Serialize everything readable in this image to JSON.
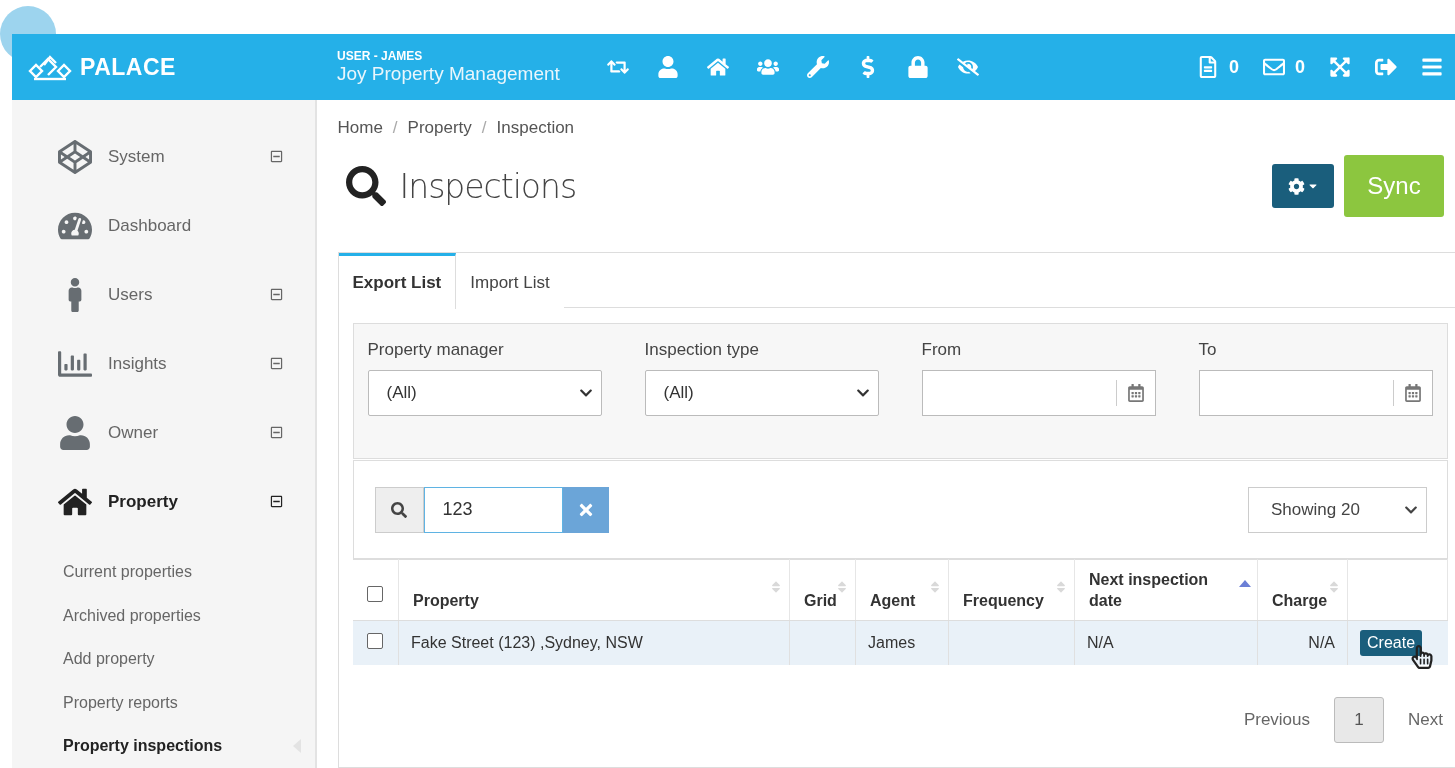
{
  "header": {
    "logo": "PALACE",
    "user_label": "USER - JAMES",
    "company": "Joy Property Management",
    "counters": [
      {
        "count": "0"
      },
      {
        "count": "0"
      }
    ]
  },
  "sidebar": {
    "items": [
      {
        "label": "System",
        "collapsible": true,
        "selected": false
      },
      {
        "label": "Dashboard",
        "collapsible": false,
        "selected": false
      },
      {
        "label": "Users",
        "collapsible": true,
        "selected": false
      },
      {
        "label": "Insights",
        "collapsible": true,
        "selected": false
      },
      {
        "label": "Owner",
        "collapsible": true,
        "selected": false
      },
      {
        "label": "Property",
        "collapsible": true,
        "selected": true,
        "children": [
          {
            "label": "Current properties",
            "selected": false
          },
          {
            "label": "Archived properties",
            "selected": false
          },
          {
            "label": "Add property",
            "selected": false
          },
          {
            "label": "Property reports",
            "selected": false
          },
          {
            "label": "Property inspections",
            "selected": true
          }
        ]
      }
    ]
  },
  "breadcrumb": {
    "separator": "/",
    "items": [
      "Home",
      "Property",
      "Inspection"
    ]
  },
  "page_title": "Inspections",
  "sync_button": "Sync",
  "tabs": [
    {
      "label": "Export List",
      "selected": true
    },
    {
      "label": "Import List",
      "selected": false
    }
  ],
  "filters": [
    {
      "kind": "select",
      "label": "Property manager",
      "value": "(All)"
    },
    {
      "kind": "select",
      "label": "Inspection type",
      "value": "(All)"
    },
    {
      "kind": "date",
      "label": "From"
    },
    {
      "kind": "date",
      "label": "To"
    }
  ],
  "search": {
    "value": "123"
  },
  "page_size": "Showing 20",
  "table": {
    "all_checked": false,
    "columns": [
      {
        "label": "Property",
        "sorted": false
      },
      {
        "label": "Grid",
        "sorted": false
      },
      {
        "label": "Agent",
        "sorted": false
      },
      {
        "label": "Frequency",
        "sorted": false
      },
      {
        "label": "Next inspection date",
        "sorted": true
      },
      {
        "label": "Charge",
        "sorted": false
      }
    ],
    "rows": [
      {
        "checked": false,
        "cells": [
          "Fake Street (123) ,Sydney, NSW",
          "",
          "James",
          "",
          "N/A",
          "N/A"
        ],
        "action": "Create"
      }
    ]
  },
  "pagination": {
    "previous": "Previous",
    "pages": [
      {
        "label": "1",
        "selected": true
      }
    ],
    "next": "Next"
  }
}
